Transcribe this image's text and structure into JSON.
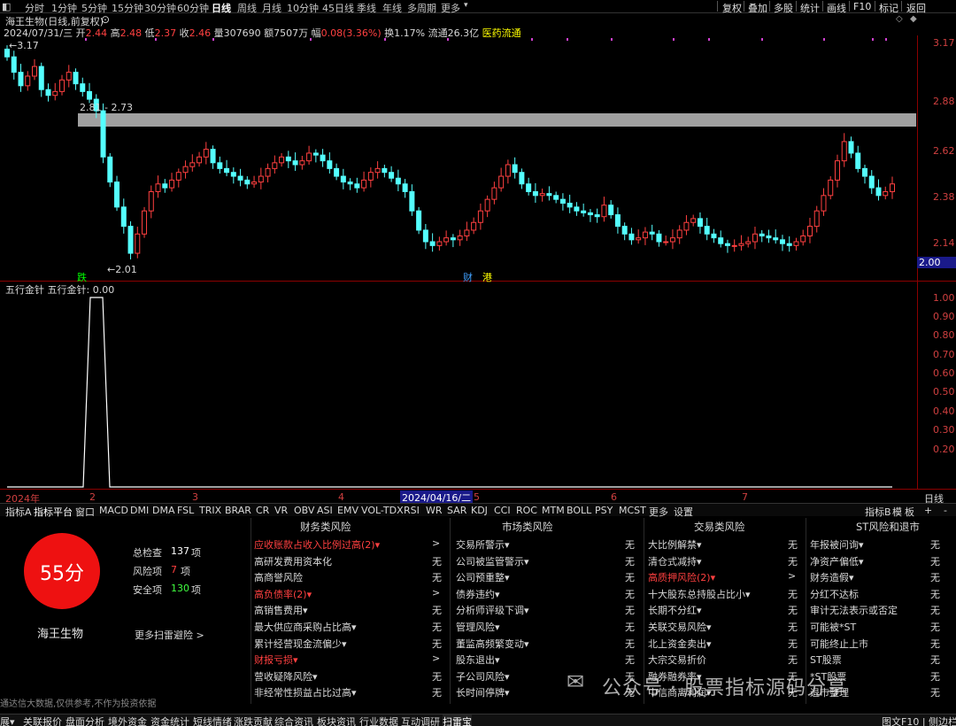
{
  "period_bar": {
    "items": [
      "分时",
      "1分钟",
      "5分钟",
      "15分钟",
      "30分钟",
      "60分钟",
      "日线",
      "周线",
      "月线",
      "10分钟",
      "45日线",
      "季线",
      "年线",
      "多周期",
      "更多"
    ],
    "active": "日线",
    "right_buttons": [
      "复权",
      "叠加",
      "多股",
      "统计",
      "画线",
      "F10",
      "标记",
      "返回"
    ]
  },
  "header": {
    "stock_title": "海王生物(日线,前复权)",
    "date": "2024/07/31/三",
    "open_label": "开",
    "open": "2.44",
    "high_label": "高",
    "high": "2.48",
    "low_label": "低",
    "low": "2.37",
    "close_label": "收",
    "close": "2.46",
    "volume_label": "量",
    "volume": "307690",
    "amount_label": "额",
    "amount": "7507万",
    "change_label": "幅",
    "change": "0.08(3.36%)",
    "turnover": "换1.17%",
    "float": "流通26.3亿",
    "sector": "医药流通"
  },
  "price_chart": {
    "price_axis": [
      "3.17",
      "2.88",
      "2.62",
      "2.38",
      "2.14"
    ],
    "current_price_tag": "2.00",
    "annotations": {
      "high_marker": "3.17",
      "low_marker": "2.01",
      "band_label": "2.81 - 2.73",
      "tag_die": "跌",
      "tag_cai": "财",
      "tag_gang": "港"
    },
    "colors": {
      "up": "#ff4040",
      "down": "#54ffff",
      "band": "#a0a0a0"
    }
  },
  "indicator_panel": {
    "title": "五行金针  五行金针: 0.00",
    "axis": [
      "1.00",
      "0.90",
      "0.80",
      "0.70",
      "0.60",
      "0.50",
      "0.40",
      "0.30",
      "0.20"
    ]
  },
  "time_axis": {
    "labels": [
      "2024年",
      "2",
      "3",
      "4",
      "5",
      "6",
      "7"
    ],
    "highlight": "2024/04/16/二",
    "right_label": "日线"
  },
  "tab_bar": {
    "tabs": [
      "指标A",
      "指标平台",
      "窗口",
      "MACD",
      "DMI",
      "DMA",
      "FSL",
      "TRIX",
      "BRAR",
      "CR",
      "VR",
      "OBV",
      "ASI",
      "EMV",
      "VOL-TDX",
      "RSI",
      "WR",
      "SAR",
      "KDJ",
      "CCI",
      "ROC",
      "MTM",
      "BOLL",
      "PSY",
      "MCST",
      "更多",
      "设置"
    ],
    "right": [
      "指标B",
      "模",
      "板",
      "+",
      "-"
    ]
  },
  "risk_summary": {
    "score": "55分",
    "stock_name": "海王生物",
    "total_label": "总检查",
    "total_value": "137",
    "total_unit": "项",
    "risk_label": "风险项",
    "risk_value": "7",
    "risk_unit": "项",
    "safe_label": "安全项",
    "safe_value": "130",
    "safe_unit": "项",
    "more_link": "更多扫雷避险 >",
    "footer_note": "通达信大数据,仅供参考,不作为投资依据"
  },
  "risk_columns": [
    {
      "header": "财务类风险",
      "items": [
        {
          "label": "应收账款占收入比例过高(2)▾",
          "value": ">",
          "risk": true
        },
        {
          "label": "高研发费用资本化",
          "value": "无",
          "risk": false
        },
        {
          "label": "高商誉风险",
          "value": "无",
          "risk": false
        },
        {
          "label": "高负债率(2)▾",
          "value": ">",
          "risk": true
        },
        {
          "label": "高销售费用▾",
          "value": "无",
          "risk": false
        },
        {
          "label": "最大供应商采购占比高▾",
          "value": "无",
          "risk": false
        },
        {
          "label": "累计经营现金流偏少▾",
          "value": "无",
          "risk": false
        },
        {
          "label": "财报亏损▾",
          "value": ">",
          "risk": true
        },
        {
          "label": "营收疑降风险▾",
          "value": "无",
          "risk": false
        },
        {
          "label": "非经常性损益占比过高▾",
          "value": "无",
          "risk": false
        }
      ]
    },
    {
      "header": "市场类风险",
      "items": [
        {
          "label": "交易所警示▾",
          "value": "无",
          "risk": false
        },
        {
          "label": "公司被监管警示▾",
          "value": "无",
          "risk": false
        },
        {
          "label": "公司预重整▾",
          "value": "无",
          "risk": false
        },
        {
          "label": "债券违约▾",
          "value": "无",
          "risk": false
        },
        {
          "label": "分析师评级下调▾",
          "value": "无",
          "risk": false
        },
        {
          "label": "管理风险▾",
          "value": "无",
          "risk": false
        },
        {
          "label": "董监高频繁变动▾",
          "value": "无",
          "risk": false
        },
        {
          "label": "股东退出▾",
          "value": "无",
          "risk": false
        },
        {
          "label": "子公司风险▾",
          "value": "无",
          "risk": false
        },
        {
          "label": "长时间停牌▾",
          "value": "无",
          "risk": false
        }
      ]
    },
    {
      "header": "交易类风险",
      "items": [
        {
          "label": "大比例解禁▾",
          "value": "无",
          "risk": false
        },
        {
          "label": "清仓式减持▾",
          "value": "无",
          "risk": false
        },
        {
          "label": "高质押风险(2)▾",
          "value": ">",
          "risk": true
        },
        {
          "label": "十大股东总持股占比小▾",
          "value": "无",
          "risk": false
        },
        {
          "label": "长期不分红▾",
          "value": "无",
          "risk": false
        },
        {
          "label": "关联交易风险▾",
          "value": "无",
          "risk": false
        },
        {
          "label": "北上资金卖出▾",
          "value": "无",
          "risk": false
        },
        {
          "label": "大宗交易折价",
          "value": "无",
          "risk": false
        },
        {
          "label": "融券融券率▾",
          "value": "无",
          "risk": false
        },
        {
          "label": "中信商离利润▾",
          "value": "无",
          "risk": false
        }
      ]
    },
    {
      "header": "ST风险和退市",
      "items": [
        {
          "label": "年报被问询▾",
          "value": "无",
          "risk": false
        },
        {
          "label": "净资产偏低▾",
          "value": "无",
          "risk": false
        },
        {
          "label": "财务造假▾",
          "value": "无",
          "risk": false
        },
        {
          "label": "分红不达标",
          "value": "无",
          "risk": false
        },
        {
          "label": "审计无法表示或否定",
          "value": "无",
          "risk": false
        },
        {
          "label": "可能被*ST",
          "value": "无",
          "risk": false
        },
        {
          "label": "可能终止上市",
          "value": "无",
          "risk": false
        },
        {
          "label": "ST股票",
          "value": "无",
          "risk": false
        },
        {
          "label": "*ST股票",
          "value": "无",
          "risk": false
        },
        {
          "label": "退市整理",
          "value": "无",
          "risk": false
        }
      ]
    }
  ],
  "watermark": "公众号 · 股票指标源码分享",
  "status_bar": {
    "items": [
      "展▾",
      "关联报价",
      "盘面分析",
      "境外资金",
      "资金统计",
      "短线情绪",
      "涨跌贡献",
      "综合资讯",
      "板块资讯",
      "行业数据",
      "互动调研",
      "扫雷宝"
    ],
    "active": "扫雷宝",
    "right": "图文F10 | 侧边栏»"
  }
}
